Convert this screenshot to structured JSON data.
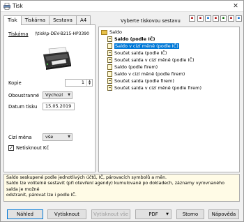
{
  "window": {
    "title": "Tisk",
    "close_label": "✕"
  },
  "tabs": [
    {
      "label": "Tisk"
    },
    {
      "label": "Tiskárna"
    },
    {
      "label": "Sestava"
    },
    {
      "label": "A4"
    }
  ],
  "left": {
    "printer_label": "Tiskárna",
    "printer_name": "\\\\tisk\\p-DEV-B215-HP3390",
    "copies_label": "Kopie",
    "copies_value": "1",
    "duplex_label": "Oboustranné",
    "duplex_value": "Výchozí",
    "date_label": "Datum tisku",
    "date_value": "15.05.2019",
    "currency_label": "Cizí měna",
    "currency_value": "vše",
    "no_print_label": "Netisknout Kč",
    "no_print_checked": true
  },
  "right": {
    "title": "Vyberte tiskovou sestavu",
    "toolbar_icons": [
      "report-icon-1",
      "report-icon-2",
      "report-icon-3",
      "report-icon-4",
      "report-icon-5",
      "report-icon-6",
      "report-icon-7",
      "report-icon-8"
    ],
    "tree_root": "Saldo",
    "tree_items": [
      {
        "label": "Saldo (podle IČ)",
        "bold": true,
        "selected": false
      },
      {
        "label": "Saldo v cizí měně (podle IČ)",
        "bold": false,
        "selected": true
      },
      {
        "label": "Součet salda (podle IČ)",
        "bold": false,
        "selected": false
      },
      {
        "label": "Součet salda v cizí měně (podle IČ)",
        "bold": false,
        "selected": false
      },
      {
        "label": "Saldo (podle firem)",
        "bold": false,
        "selected": false
      },
      {
        "label": "Saldo v cizí měně (podle firem)",
        "bold": false,
        "selected": false
      },
      {
        "label": "Součet salda (podle firem)",
        "bold": false,
        "selected": false
      },
      {
        "label": "Součet salda v cizí měně (podle firem)",
        "bold": false,
        "selected": false
      }
    ]
  },
  "description": {
    "line1": "Saldo seskupené podle jednotlivých účtů, IČ, párovacích symbolů a měn.",
    "line2": "Saldo lze volitelně sestavit (při otevření agendy) kumulované po dokladech, záznamy vyrovnaného salda je možné",
    "line3": "odstranit, párovat lze i podle IČ."
  },
  "buttons": {
    "preview": "Náhled",
    "print": "Vytisknout",
    "print_all": "Vytisknout vše",
    "pdf": "PDF",
    "cancel": "Storno",
    "help": "Nápověda"
  },
  "colors": {
    "selection": "#0078d7",
    "description_bg": "#fffbe6"
  }
}
